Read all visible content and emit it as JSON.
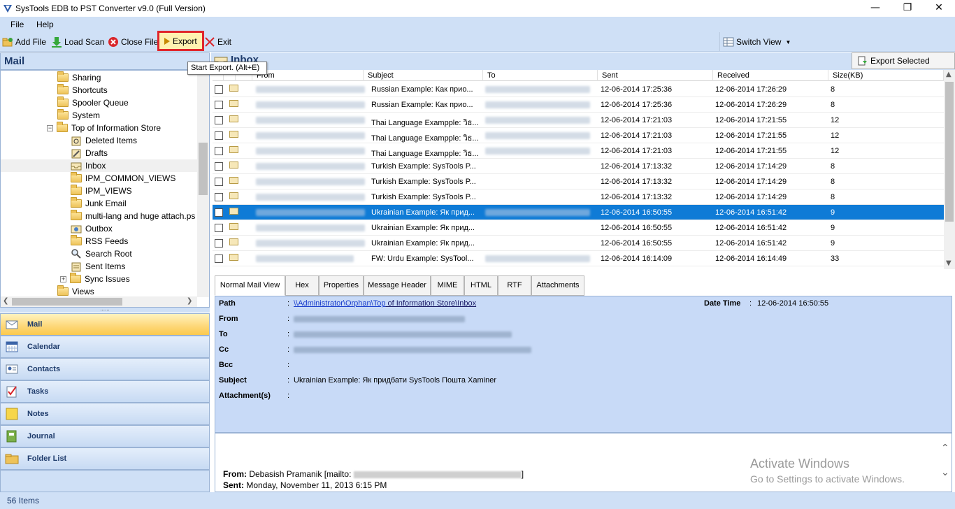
{
  "window": {
    "title": "SysTools EDB to PST Converter v9.0 (Full Version)"
  },
  "menu": {
    "items": [
      "File",
      "Help"
    ]
  },
  "toolbar": {
    "add_file": "Add File",
    "load_scan": "Load Scan",
    "close_file": "Close File",
    "export": "Export",
    "exit": "Exit",
    "switch_view": "Switch View"
  },
  "tooltip": "Start Export. (Alt+E)",
  "left": {
    "header": "Mail",
    "tree": [
      "Sharing",
      "Shortcuts",
      "Spooler Queue",
      "System",
      "Top of Information Store",
      "Deleted Items",
      "Drafts",
      "Inbox",
      "IPM_COMMON_VIEWS",
      "IPM_VIEWS",
      "Junk Email",
      "multi-lang and huge attach.ps",
      "Outbox",
      "RSS Feeds",
      "Search Root",
      "Sent Items",
      "Sync Issues",
      "Views"
    ],
    "nav": [
      "Mail",
      "Calendar",
      "Contacts",
      "Tasks",
      "Notes",
      "Journal",
      "Folder List"
    ]
  },
  "right": {
    "folder_title": "Inbox",
    "export_selected": "Export Selected",
    "columns": [
      "From",
      "Subject",
      "To",
      "Sent",
      "Received",
      "Size(KB)"
    ],
    "rows": [
      {
        "subject": "Russian Example:  Как прио...",
        "sent": "12-06-2014 17:25:36",
        "received": "12-06-2014 17:26:29",
        "size": "8"
      },
      {
        "subject": "Russian Example:  Как прио...",
        "sent": "12-06-2014 17:25:36",
        "received": "12-06-2014 17:26:29",
        "size": "8"
      },
      {
        "subject": "Thai Language Exampple:  วิธ...",
        "sent": "12-06-2014 17:21:03",
        "received": "12-06-2014 17:21:55",
        "size": "12"
      },
      {
        "subject": "Thai Language Exampple:  วิธ...",
        "sent": "12-06-2014 17:21:03",
        "received": "12-06-2014 17:21:55",
        "size": "12"
      },
      {
        "subject": "Thai Language Exampple:  วิธ...",
        "sent": "12-06-2014 17:21:03",
        "received": "12-06-2014 17:21:55",
        "size": "12"
      },
      {
        "subject": "Turkish Example:  SysTools P...",
        "sent": "12-06-2014 17:13:32",
        "received": "12-06-2014 17:14:29",
        "size": "8"
      },
      {
        "subject": "Turkish Example:  SysTools P...",
        "sent": "12-06-2014 17:13:32",
        "received": "12-06-2014 17:14:29",
        "size": "8"
      },
      {
        "subject": "Turkish Example:  SysTools P...",
        "sent": "12-06-2014 17:13:32",
        "received": "12-06-2014 17:14:29",
        "size": "8"
      },
      {
        "subject": "Ukrainian Example:  Як прид...",
        "sent": "12-06-2014 16:50:55",
        "received": "12-06-2014 16:51:42",
        "size": "9"
      },
      {
        "subject": "Ukrainian Example:  Як прид...",
        "sent": "12-06-2014 16:50:55",
        "received": "12-06-2014 16:51:42",
        "size": "9"
      },
      {
        "subject": "Ukrainian Example:  Як прид...",
        "sent": "12-06-2014 16:50:55",
        "received": "12-06-2014 16:51:42",
        "size": "9"
      },
      {
        "subject": "FW:  Urdu Example:  SysTool...",
        "sent": "12-06-2014 16:14:09",
        "received": "12-06-2014 16:14:49",
        "size": "33"
      }
    ],
    "tabs": [
      "Normal Mail View",
      "Hex",
      "Properties",
      "Message Header",
      "MIME",
      "HTML",
      "RTF",
      "Attachments"
    ]
  },
  "detail": {
    "path_label": "Path",
    "path_parts": [
      "\\\\Administrator\\Orphan\\Top",
      " of Information Store\\Inbox"
    ],
    "date_label": "Date Time",
    "date_value": "12-06-2014 16:50:55",
    "from_label": "From",
    "to_label": "To",
    "cc_label": "Cc",
    "bcc_label": "Bcc",
    "subject_label": "Subject",
    "subject_value": "Ukrainian Example:  Як придбати SysTools Пошта Xaminer",
    "attachments_label": "Attachment(s)",
    "colon": ":"
  },
  "body": {
    "from_label": "From:",
    "from_value": "Debasish Pramanik [mailto:",
    "sent_label": "Sent:",
    "sent_value": "Monday, November 11, 2013 6:15 PM"
  },
  "watermark": {
    "title": "Activate Windows",
    "subtitle": "Go to Settings to activate Windows."
  },
  "status": "56 Items"
}
